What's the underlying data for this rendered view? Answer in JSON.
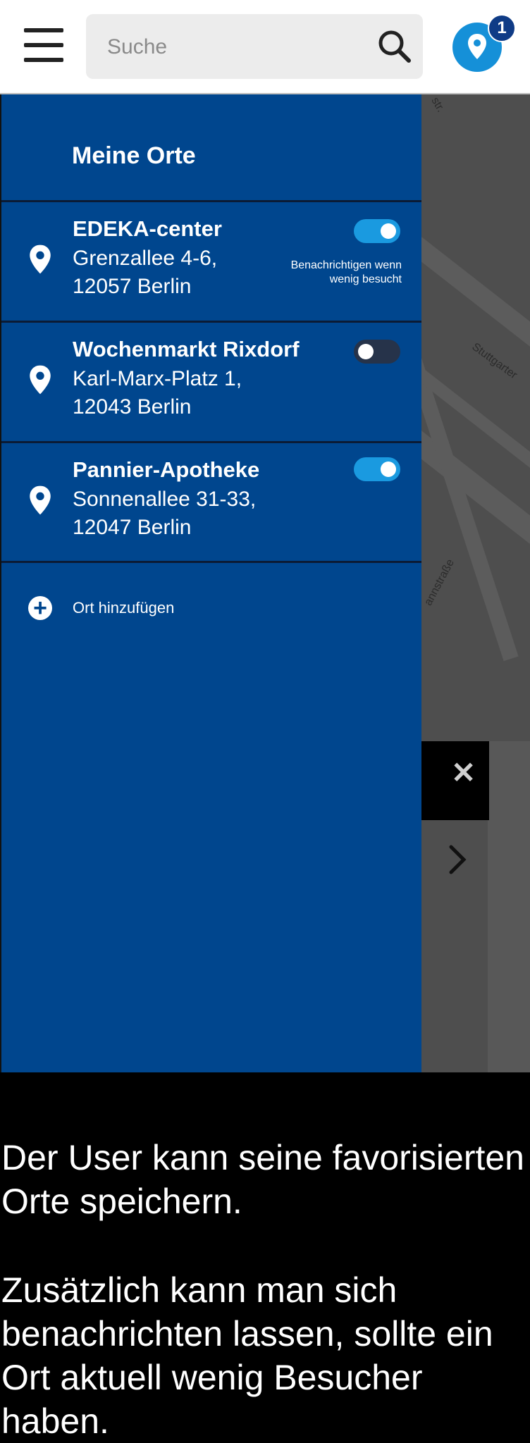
{
  "search": {
    "placeholder": "Suche"
  },
  "location_badge": {
    "count": "1"
  },
  "drawer": {
    "title": "Meine Orte",
    "places": [
      {
        "name": "EDEKA-center",
        "address_line1": "Grenzallee 4-6,",
        "address_line2": "12057 Berlin",
        "notify_enabled": true,
        "notify_hint": "Benachrichtigen wenn wenig besucht"
      },
      {
        "name": "Wochenmarkt Rixdorf",
        "address_line1": "Karl-Marx-Platz 1,",
        "address_line2": "12043 Berlin",
        "notify_enabled": false
      },
      {
        "name": "Pannier-Apotheke",
        "address_line1": "Sonnenallee 31-33,",
        "address_line2": "12047 Berlin",
        "notify_enabled": true
      }
    ],
    "add_place_label": "Ort hinzufügen"
  },
  "map": {
    "street_labels": [
      "str.",
      "Stuttgarter",
      "annstraße"
    ]
  },
  "caption": {
    "paragraph1": "Der User kann seine favorisierten Orte speichern.",
    "paragraph2": "Zusätzlich kann man sich benachrichten lassen, sollte ein Ort aktuell wenig Besucher haben."
  },
  "colors": {
    "drawer_bg": "#00468e",
    "accent": "#1a9ae0",
    "badge": "#0f3b86"
  },
  "icons": {
    "menu": "hamburger-icon",
    "search": "search-icon",
    "location": "location-pin-icon",
    "add": "plus-circle-icon",
    "close": "close-icon",
    "next": "chevron-right-icon"
  }
}
